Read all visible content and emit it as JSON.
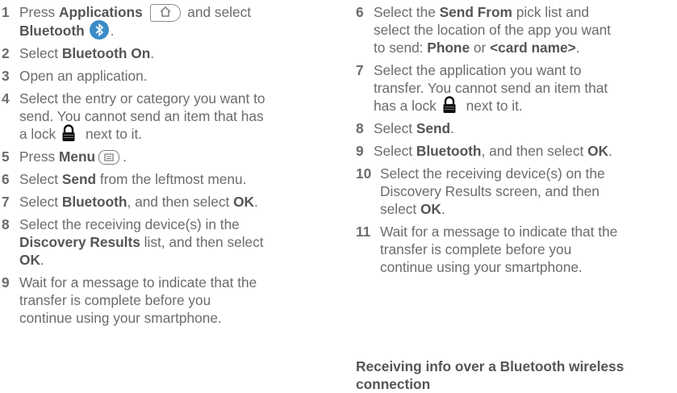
{
  "left_steps": [
    {
      "num": "1",
      "l1a": "Press ",
      "l1b": "Applications",
      "l1c": " and select",
      "l2a": "Bluetooth",
      "l2b": "."
    },
    {
      "num": "2",
      "a": "Select ",
      "b": "Bluetooth On",
      "c": "."
    },
    {
      "num": "3",
      "text": "Open an application."
    },
    {
      "num": "4",
      "l1": "Select the entry or category you want to",
      "l2": "send. You cannot send an item that has",
      "l3a": "a lock",
      "l3b": " next to it."
    },
    {
      "num": "5",
      "a": "Press ",
      "b": "Menu",
      "c": "."
    },
    {
      "num": "6",
      "a": "Select ",
      "b": "Send",
      "c": " from the leftmost menu."
    },
    {
      "num": "7",
      "a": "Select ",
      "b": "Bluetooth",
      "c": ", and then select ",
      "d": "OK",
      "e": "."
    },
    {
      "num": "8",
      "l1": "Select the receiving device(s) in the",
      "l2a": "Discovery Results",
      "l2b": " list, and then select",
      "l3": "OK",
      "l3b": "."
    },
    {
      "num": "9",
      "l1": "Wait for a message to indicate that the",
      "l2": "transfer is complete before you",
      "l3": "continue using your smartphone."
    }
  ],
  "right_steps": [
    {
      "num": "6",
      "l1a": "Select the ",
      "l1b": "Send From",
      "l1c": " pick list and",
      "l2": "select the location of the app you want",
      "l3a": "to send: ",
      "l3b": "Phone",
      "l3c": " or ",
      "l3d": "<card name>",
      "l3e": "."
    },
    {
      "num": "7",
      "l1": "Select the application you want to",
      "l2": "transfer. You cannot send an item that",
      "l3a": "has a lock",
      "l3b": " next to it."
    },
    {
      "num": "8",
      "a": "Select ",
      "b": "Send",
      "c": "."
    },
    {
      "num": "9",
      "a": "Select ",
      "b": "Bluetooth",
      "c": ", and then select ",
      "d": "OK",
      "e": "."
    },
    {
      "num": "10",
      "l1": "Select the receiving device(s) on the",
      "l2": "Discovery Results screen, and then",
      "l3a": "select ",
      "l3b": "OK",
      "l3c": "."
    },
    {
      "num": "11",
      "l1": "Wait for a message to indicate that the",
      "l2": "transfer is complete before you",
      "l3": "continue using your smartphone."
    }
  ],
  "section_title_line1": "Receiving info over a Bluetooth wireless",
  "section_title_line2": "connection",
  "icons": {
    "applications": "applications-key-icon",
    "bluetooth": "bluetooth-icon",
    "menu": "menu-key-icon",
    "lock": "lock-icon"
  },
  "colors": {
    "text": "#6b6b6b",
    "bold": "#555555",
    "bluetooth": "#3b8cc7"
  }
}
